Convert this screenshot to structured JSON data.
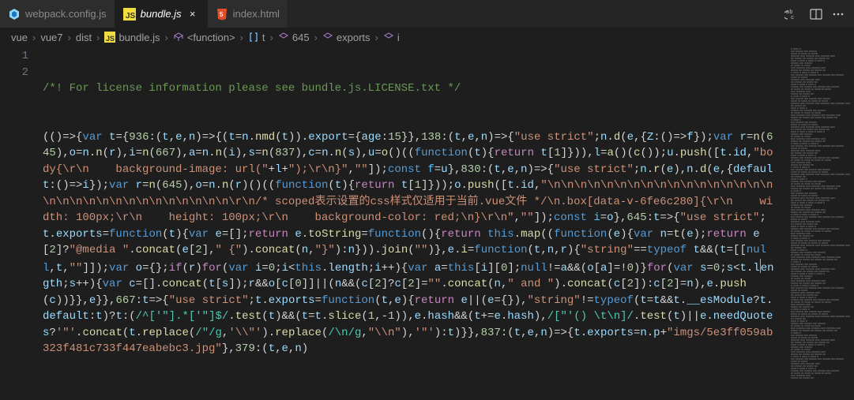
{
  "tabs": [
    {
      "label": "webpack.config.js",
      "icon": "webpack",
      "active": false
    },
    {
      "label": "bundle.js",
      "icon": "js",
      "active": true
    },
    {
      "label": "index.html",
      "icon": "html",
      "active": false
    }
  ],
  "actions": {
    "abc": "abc",
    "split": "split",
    "more": "..."
  },
  "breadcrumbs": [
    {
      "label": "vue",
      "icon": null
    },
    {
      "label": "vue7",
      "icon": null
    },
    {
      "label": "dist",
      "icon": null
    },
    {
      "label": "bundle.js",
      "icon": "js"
    },
    {
      "label": "<function>",
      "icon": "cube"
    },
    {
      "label": "t",
      "icon": "brackets"
    },
    {
      "label": "645",
      "icon": "cube"
    },
    {
      "label": "exports",
      "icon": "cube"
    },
    {
      "label": "i",
      "icon": "cube"
    }
  ],
  "gutter": {
    "line1": "1",
    "line2": "2"
  },
  "code": {
    "line1": "/*! For license information please see bundle.js.LICENSE.txt */",
    "line2_html": "<span class='tok-paren'>(()=&gt;{</span><span class='tok-kw'>var</span> <span class='tok-var'>t</span>={<span class='tok-num'>936</span><span class='tok-op'>:</span>(<span class='tok-var'>t</span>,<span class='tok-var'>e</span>,<span class='tok-var'>n</span>)=&gt;{(<span class='tok-var'>t</span>=<span class='tok-var'>n</span>.<span class='tok-func'>nmd</span>(<span class='tok-var'>t</span>)).<span class='tok-var'>export</span>={<span class='tok-var'>age</span>:<span class='tok-num'>15</span>}},<span class='tok-num'>138</span><span class='tok-op'>:</span>(<span class='tok-var'>t</span>,<span class='tok-var'>e</span>,<span class='tok-var'>n</span>)=&gt;{<span class='tok-str'>\"use strict\"</span>;<span class='tok-var'>n</span>.<span class='tok-func'>d</span>(<span class='tok-var'>e</span>,{<span class='tok-var'>Z</span>:()=&gt;<span class='tok-var'>f</span>});<span class='tok-kw'>var</span> <span class='tok-var'>r</span>=<span class='tok-func'>n</span>(<span class='tok-num'>645</span>),<span class='tok-var'>o</span>=<span class='tok-var'>n</span>.<span class='tok-func'>n</span>(<span class='tok-var'>r</span>),<span class='tok-var'>i</span>=<span class='tok-func'>n</span>(<span class='tok-num'>667</span>),<span class='tok-var'>a</span>=<span class='tok-var'>n</span>.<span class='tok-func'>n</span>(<span class='tok-var'>i</span>),<span class='tok-var'>s</span>=<span class='tok-func'>n</span>(<span class='tok-num'>837</span>),<span class='tok-var'>c</span>=<span class='tok-var'>n</span>.<span class='tok-func'>n</span>(<span class='tok-var'>s</span>),<span class='tok-var'>u</span>=<span class='tok-func'>o</span>()((<span class='tok-kw'>function</span>(<span class='tok-var'>t</span>){<span class='tok-kwctrl'>return</span> <span class='tok-var'>t</span>[<span class='tok-num'>1</span>]})),<span class='tok-var'>l</span>=<span class='tok-func'>a</span>()(<span class='tok-func'>c</span>());<span class='tok-var'>u</span>.<span class='tok-func'>push</span>([<span class='tok-var'>t</span>.<span class='tok-var'>id</span>,<span class='tok-str'>\"body{\\r\\n    background-image: url(\"</span>+<span class='tok-var'>l</span>+<span class='tok-str'>\");\\r\\n}\"</span>,<span class='tok-str'>\"\"</span>]);<span class='tok-kw'>const</span> <span class='tok-const'>f</span>=<span class='tok-var'>u</span>},<span class='tok-num'>830</span><span class='tok-op'>:</span>(<span class='tok-var'>t</span>,<span class='tok-var'>e</span>,<span class='tok-var'>n</span>)=&gt;{<span class='tok-str'>\"use strict\"</span>;<span class='tok-var'>n</span>.<span class='tok-func'>r</span>(<span class='tok-var'>e</span>),<span class='tok-var'>n</span>.<span class='tok-func'>d</span>(<span class='tok-var'>e</span>,{<span class='tok-var'>default</span>:()=&gt;<span class='tok-var'>i</span>});<span class='tok-kw'>var</span> <span class='tok-var'>r</span>=<span class='tok-func'>n</span>(<span class='tok-num'>645</span>),<span class='tok-var'>o</span>=<span class='tok-var'>n</span>.<span class='tok-func'>n</span>(<span class='tok-var'>r</span>)()((<span class='tok-kw'>function</span>(<span class='tok-var'>t</span>){<span class='tok-kwctrl'>return</span> <span class='tok-var'>t</span>[<span class='tok-num'>1</span>]}));<span class='tok-var'>o</span>.<span class='tok-func'>push</span>([<span class='tok-var'>t</span>.<span class='tok-var'>id</span>,<span class='tok-str'>\"\\n\\n\\n\\n\\n\\n\\n\\n\\n\\n\\n\\n\\n\\n\\n\\n\\n\\n\\n\\n\\n\\n\\n\\n\\n\\n\\n\\n\\n\\n\\n\\r\\n/* scoped表示设置的css样式仅适用于当前.vue文件 */\\n.box[data-v-6fe6c280]{\\r\\n    width: 100px;\\r\\n    height: 100px;\\r\\n    background-color: red;\\n}\\r\\n\"</span>,<span class='tok-str'>\"\"</span>]);<span class='tok-kw'>const</span> <span class='tok-const'>i</span>=<span class='tok-var'>o</span>},<span class='tok-num'>645</span><span class='tok-op'>:</span><span class='tok-var'>t</span>=&gt;{<span class='tok-str'>\"use strict\"</span>;<span class='tok-var'>t</span>.<span class='tok-var'>exports</span>=<span class='tok-kw'>function</span>(<span class='tok-var'>t</span>){<span class='tok-kw'>var</span> <span class='tok-var'>e</span>=[];<span class='tok-kwctrl'>return</span> <span class='tok-var'>e</span>.<span class='tok-func'>toString</span>=<span class='tok-kw'>function</span>(){<span class='tok-kwctrl'>return</span> <span class='tok-kw'>this</span>.<span class='tok-func'>map</span>((<span class='tok-kw'>function</span>(<span class='tok-var'>e</span>){<span class='tok-kw'>var</span> <span class='tok-var'>n</span>=<span class='tok-func'>t</span>(<span class='tok-var'>e</span>);<span class='tok-kwctrl'>return</span> <span class='tok-var'>e</span>[<span class='tok-num'>2</span>]?<span class='tok-str'>\"@media \"</span>.<span class='tok-func'>concat</span>(<span class='tok-var'>e</span>[<span class='tok-num'>2</span>],<span class='tok-str'>\" {\"</span>).<span class='tok-func'>concat</span>(<span class='tok-var'>n</span>,<span class='tok-str'>\"}\"</span>):<span class='tok-var'>n</span>})).<span class='tok-func'>join</span>(<span class='tok-str'>\"\"</span>)},<span class='tok-var'>e</span>.<span class='tok-func'>i</span>=<span class='tok-kw'>function</span>(<span class='tok-var'>t</span>,<span class='tok-var'>n</span>,<span class='tok-var'>r</span>){<span class='tok-str'>\"string\"</span>==<span class='tok-kw'>typeof</span> <span class='tok-var'>t</span>&amp;&amp;(<span class='tok-var'>t</span>=[[<span class='tok-kw'>null</span>,<span class='tok-var'>t</span>,<span class='tok-str'>\"\"</span>]]);<span class='tok-kw'>var</span> <span class='tok-var'>o</span>={};<span class='tok-kwctrl'>if</span>(<span class='tok-var'>r</span>)<span class='tok-kwctrl'>for</span>(<span class='tok-kw'>var</span> <span class='tok-var'>i</span>=<span class='tok-num'>0</span>;<span class='tok-var'>i</span>&lt;<span class='tok-kw'>this</span>.<span class='tok-var'>length</span>;<span class='tok-var'>i</span>++){<span class='tok-kw'>var</span> <span class='tok-var'>a</span>=<span class='tok-kw'>this</span>[<span class='tok-var'>i</span>][<span class='tok-num'>0</span>];<span class='tok-kw'>null</span>!=<span class='tok-var'>a</span>&amp;&amp;(<span class='tok-var'>o</span>[<span class='tok-var'>a</span>]=!<span class='tok-num'>0</span>)}<span class='tok-kwctrl'>for</span>(<span class='tok-kw'>var</span> <span class='tok-var'>s</span>=<span class='tok-num'>0</span>;<span class='tok-var'>s</span>&lt;<span class='tok-var'>t</span>.<span class='tok-var'>l</span><span class='cursor-line'></span><span class='tok-var'>ength</span>;<span class='tok-var'>s</span>++){<span class='tok-kw'>var</span> <span class='tok-var'>c</span>=[].<span class='tok-func'>concat</span>(<span class='tok-var'>t</span>[<span class='tok-var'>s</span>]);<span class='tok-var'>r</span>&amp;&amp;<span class='tok-var'>o</span>[<span class='tok-var'>c</span>[<span class='tok-num'>0</span>]]||(<span class='tok-var'>n</span>&amp;&amp;(<span class='tok-var'>c</span>[<span class='tok-num'>2</span>]?<span class='tok-var'>c</span>[<span class='tok-num'>2</span>]=<span class='tok-str'>\"\"</span>.<span class='tok-func'>concat</span>(<span class='tok-var'>n</span>,<span class='tok-str'>\" and \"</span>).<span class='tok-func'>concat</span>(<span class='tok-var'>c</span>[<span class='tok-num'>2</span>]):<span class='tok-var'>c</span>[<span class='tok-num'>2</span>]=<span class='tok-var'>n</span>),<span class='tok-var'>e</span>.<span class='tok-func'>push</span>(<span class='tok-var'>c</span>))}},<span class='tok-var'>e</span>}},<span class='tok-num'>667</span><span class='tok-op'>:</span><span class='tok-var'>t</span>=&gt;{<span class='tok-str'>\"use strict\"</span>;<span class='tok-var'>t</span>.<span class='tok-var'>exports</span>=<span class='tok-kw'>function</span>(<span class='tok-var'>t</span>,<span class='tok-var'>e</span>){<span class='tok-kwctrl'>return</span> <span class='tok-var'>e</span>||(<span class='tok-var'>e</span>={}),<span class='tok-str'>\"string\"</span>!=<span class='tok-kw'>typeof</span>(<span class='tok-var'>t</span>=<span class='tok-var'>t</span>&amp;&amp;<span class='tok-var'>t</span>.<span class='tok-var'>__esModule</span>?<span class='tok-var'>t</span>.<span class='tok-var'>default</span>:<span class='tok-var'>t</span>)?<span class='tok-var'>t</span>:(<span class='tok-type'>/^['\"].*['\"]$/</span>.<span class='tok-func'>test</span>(<span class='tok-var'>t</span>)&amp;&amp;(<span class='tok-var'>t</span>=<span class='tok-var'>t</span>.<span class='tok-func'>slice</span>(<span class='tok-num'>1</span>,-<span class='tok-num'>1</span>)),<span class='tok-var'>e</span>.<span class='tok-var'>hash</span>&amp;&amp;(<span class='tok-var'>t</span>+=<span class='tok-var'>e</span>.<span class='tok-var'>hash</span>),<span class='tok-type'>/[\"'() \\t\\n]/</span>.<span class='tok-func'>test</span>(<span class='tok-var'>t</span>)||<span class='tok-var'>e</span>.<span class='tok-var'>needQuotes</span>?<span class='tok-str'>'\"'</span>.<span class='tok-func'>concat</span>(<span class='tok-var'>t</span>.<span class='tok-func'>replace</span>(<span class='tok-type'>/\"/g</span>,<span class='tok-str'>'\\\\\"'</span>).<span class='tok-func'>replace</span>(<span class='tok-type'>/\\n/g</span>,<span class='tok-str'>\"\\\\n\"</span>),<span class='tok-str'>'\"'</span>):<span class='tok-var'>t</span>)}},<span class='tok-num'>837</span><span class='tok-op'>:</span>(<span class='tok-var'>t</span>,<span class='tok-var'>e</span>,<span class='tok-var'>n</span>)=&gt;{<span class='tok-var'>t</span>.<span class='tok-var'>exports</span>=<span class='tok-var'>n</span>.<span class='tok-var'>p</span>+<span class='tok-str'>\"imgs/5e3ff059ab323f481c733f447eabebc3.jpg\"</span>},<span class='tok-num'>379</span><span class='tok-op'>:</span>(<span class='tok-var'>t</span>,<span class='tok-var'>e</span>,<span class='tok-var'>n</span>)"
  }
}
